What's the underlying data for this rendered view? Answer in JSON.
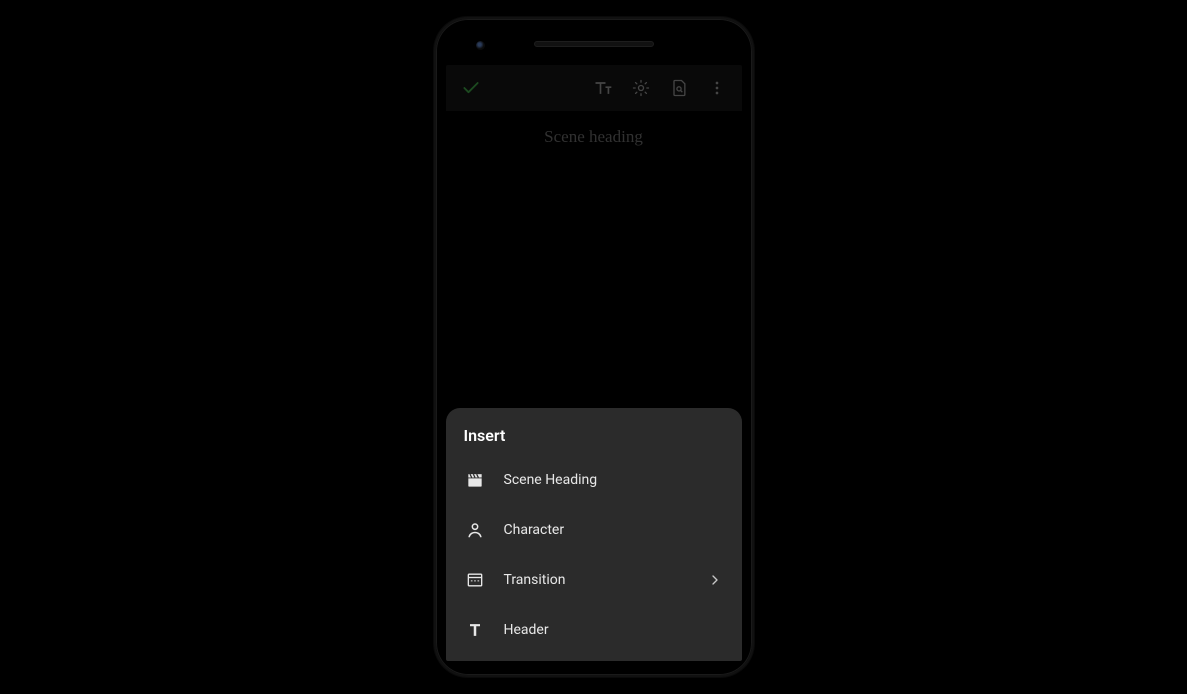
{
  "editor": {
    "title": "Scene heading"
  },
  "sheet": {
    "title": "Insert",
    "items": [
      {
        "label": "Scene Heading"
      },
      {
        "label": "Character"
      },
      {
        "label": "Transition"
      },
      {
        "label": "Header"
      }
    ]
  }
}
